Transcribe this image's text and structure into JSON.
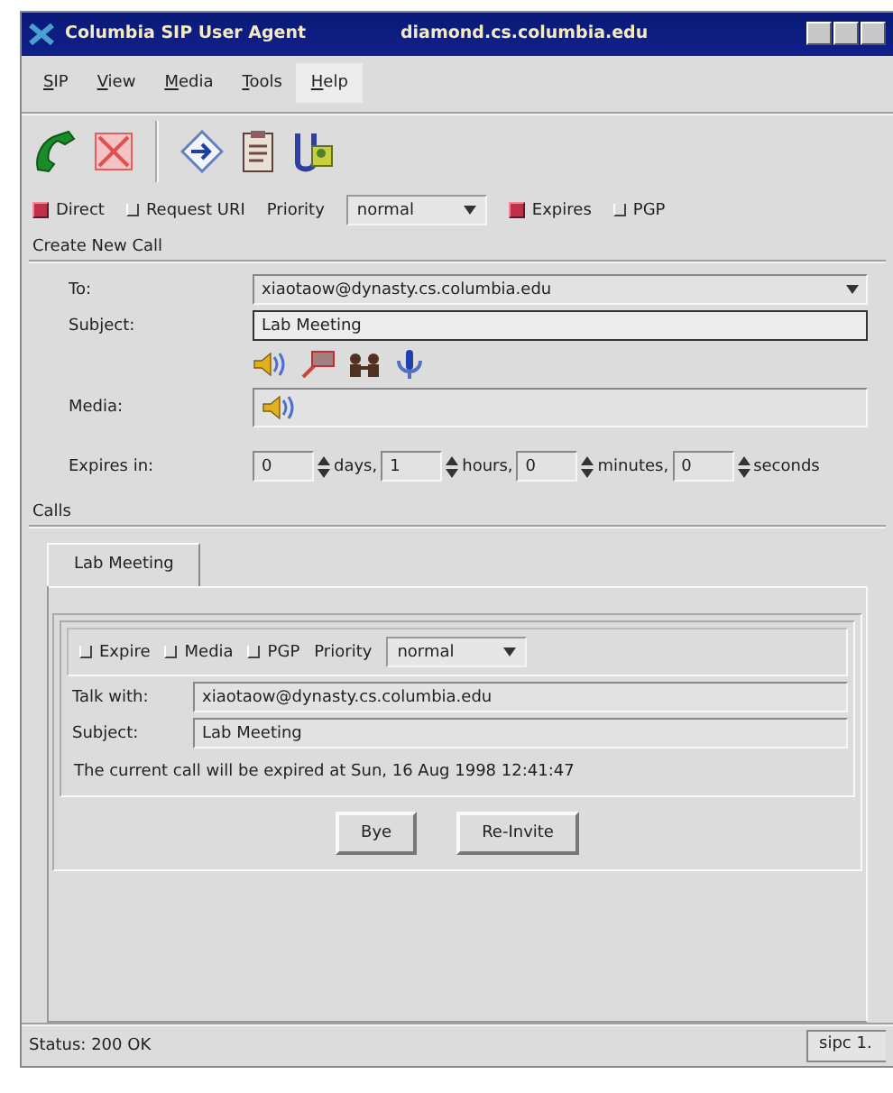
{
  "window": {
    "title": "Columbia SIP User Agent",
    "host": "diamond.cs.columbia.edu"
  },
  "menu": [
    {
      "label": "SIP",
      "selected": false
    },
    {
      "label": "View",
      "selected": false
    },
    {
      "label": "Media",
      "selected": false
    },
    {
      "label": "Tools",
      "selected": false
    },
    {
      "label": "Help",
      "selected": true
    }
  ],
  "options": [
    {
      "kind": "check",
      "label": "Direct",
      "checked": true
    },
    {
      "kind": "check",
      "label": "Request URI",
      "checked": false
    },
    {
      "kind": "label",
      "label": "Priority"
    },
    {
      "kind": "select",
      "value": "normal"
    },
    {
      "kind": "check",
      "label": "Expires",
      "checked": true
    },
    {
      "kind": "check",
      "label": "PGP",
      "checked": false
    }
  ],
  "create_call": {
    "title": "Create New Call",
    "to": {
      "label": "To:",
      "value": "xiaotaow@dynasty.cs.columbia.edu"
    },
    "subject": {
      "label": "Subject:",
      "value": "Lab Meeting"
    },
    "media": {
      "label": "Media:"
    },
    "expires": {
      "label": "Expires in:",
      "fields": [
        {
          "value": "0",
          "unit": "days,"
        },
        {
          "value": "1",
          "unit": "hours,"
        },
        {
          "value": "0",
          "unit": "minutes,"
        },
        {
          "value": "0",
          "unit": "seconds"
        }
      ]
    }
  },
  "calls": {
    "title": "Calls",
    "tabs": [
      {
        "label": "Lab Meeting",
        "selected": true
      }
    ],
    "options": [
      {
        "kind": "check",
        "label": "Expire",
        "checked": false
      },
      {
        "kind": "check",
        "label": "Media",
        "checked": false
      },
      {
        "kind": "check",
        "label": "PGP",
        "checked": false
      },
      {
        "kind": "label",
        "label": "Priority"
      },
      {
        "kind": "select",
        "value": "normal"
      }
    ],
    "talk_with": {
      "label": "Talk with:",
      "value": "xiaotaow@dynasty.cs.columbia.edu"
    },
    "subject": {
      "label": "Subject:",
      "value": "Lab Meeting"
    },
    "message": "The current call will be expired at Sun, 16 Aug 1998 12:41:47",
    "buttons": [
      "Bye",
      "Re-Invite"
    ]
  },
  "status_bar": {
    "text": "Status: 200 OK",
    "version": "sipc 1."
  }
}
